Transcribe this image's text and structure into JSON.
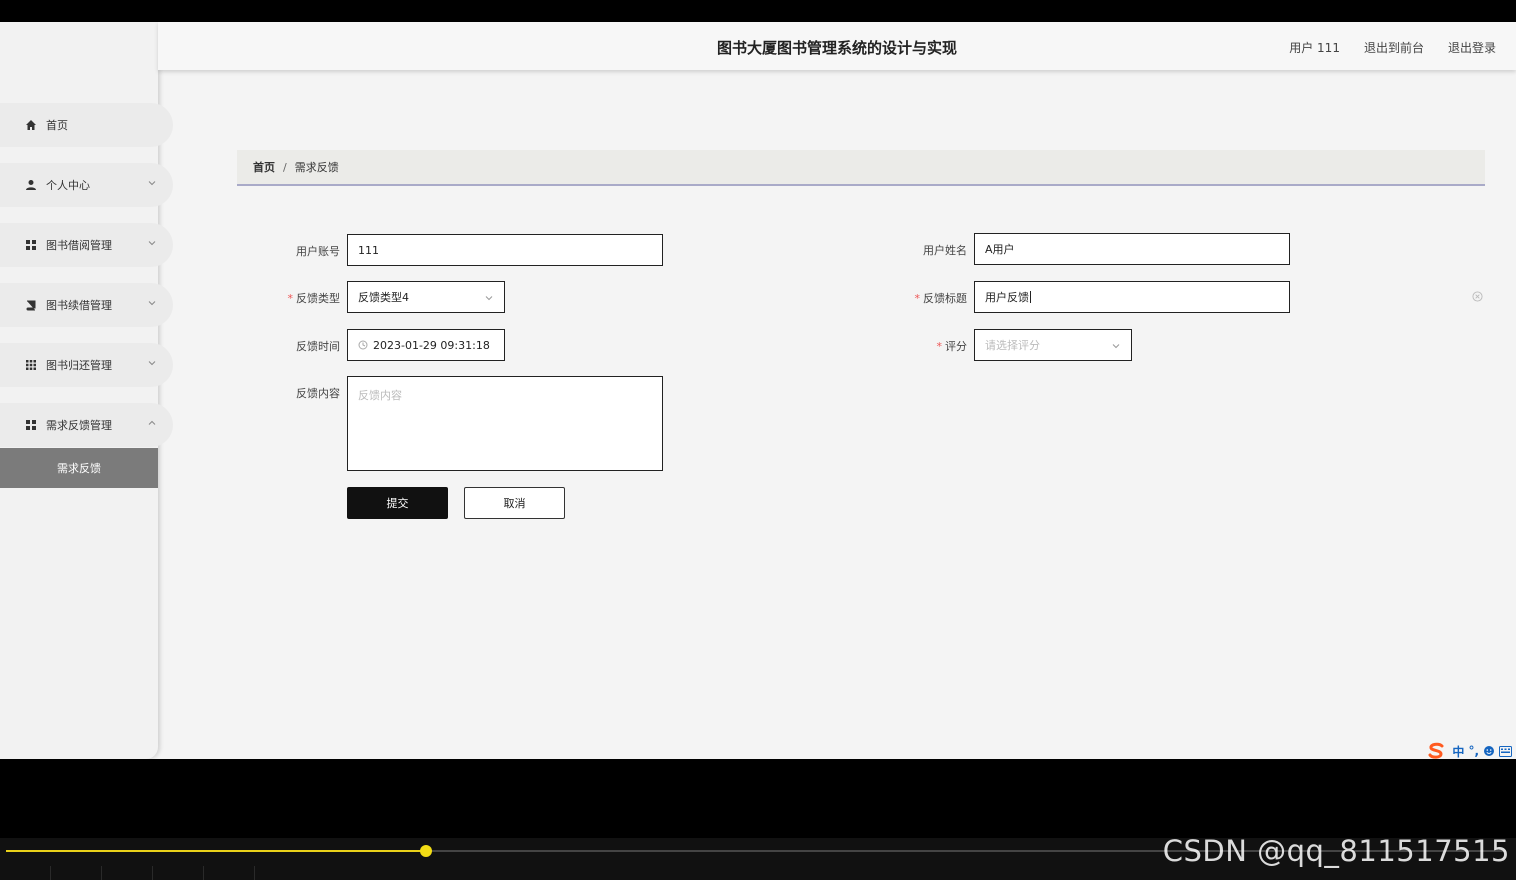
{
  "header": {
    "title": "图书大厦图书管理系统的设计与实现",
    "user": "用户 111",
    "to_front": "退出到前台",
    "logout": "退出登录"
  },
  "sidebar": {
    "items": [
      {
        "label": "首页",
        "icon": "home-icon"
      },
      {
        "label": "个人中心",
        "icon": "user-icon"
      },
      {
        "label": "图书借阅管理",
        "icon": "grid-icon"
      },
      {
        "label": "图书续借管理",
        "icon": "book-icon"
      },
      {
        "label": "图书归还管理",
        "icon": "grid9-icon"
      },
      {
        "label": "需求反馈管理",
        "icon": "grid-icon"
      }
    ],
    "submenu_active": "需求反馈"
  },
  "breadcrumb": {
    "home": "首页",
    "separator": "/",
    "current": "需求反馈"
  },
  "form": {
    "account_label": "用户账号",
    "account_value": "111",
    "name_label": "用户姓名",
    "name_value": "A用户",
    "type_label": "反馈类型",
    "type_value": "反馈类型4",
    "title_label": "反馈标题",
    "title_value": "用户反馈",
    "time_label": "反馈时间",
    "time_value": "2023-01-29 09:31:18",
    "rating_label": "评分",
    "rating_placeholder": "请选择评分",
    "content_label": "反馈内容",
    "content_placeholder": "反馈内容",
    "required_mark": "*",
    "submit": "提交",
    "cancel": "取消"
  },
  "ime": {
    "mode": "中",
    "punct": "°,"
  },
  "player": {
    "progress": 0.28
  },
  "watermark": "CSDN @qq_811517515",
  "colors": {
    "accent": "#111111",
    "breadcrumb_line": "#a9aac8",
    "progress": "#e9d11a",
    "required": "#ee5555"
  }
}
